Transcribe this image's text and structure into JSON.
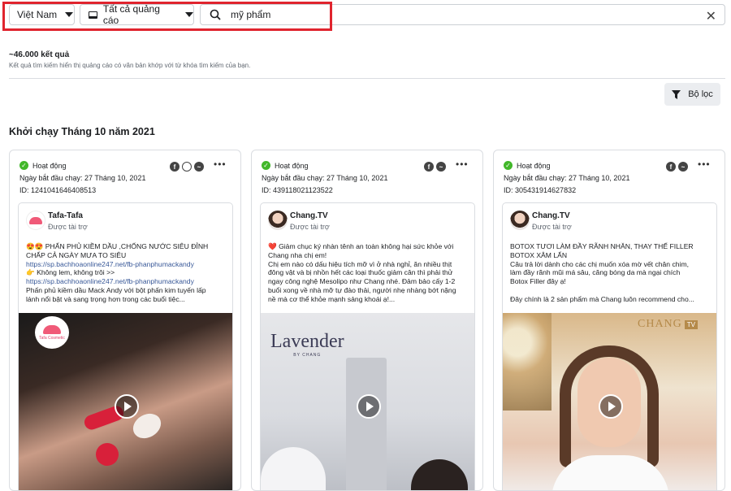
{
  "filters": {
    "country": "Việt Nam",
    "ad_type": "Tất cả quảng cáo",
    "search_value": "mỹ phẩm"
  },
  "results": {
    "count": "~46.000 kết quả",
    "subtitle": "Kết quả tìm kiếm hiển thị quảng cáo có văn bản khớp với từ khóa tìm kiếm của bạn.",
    "filter_label": "Bộ lọc",
    "section_title": "Khởi chạy Tháng 10 năm 2021"
  },
  "cards": [
    {
      "status": "Hoạt động",
      "start": "Ngày bắt đầu chạy: 27 Tháng 10, 2021",
      "id": "ID: 1241041646408513",
      "page_name": "Tafa-Tafa",
      "sponsored": "Được tài trợ",
      "lines": [
        "😍😍 PHẤN PHỦ KIỀM DẦU ,CHỐNG NƯỚC SIÊU ĐỈNH",
        "CHẤP CẢ NGÀY MƯA TO SIÊU",
        "https://sp.bachhoaonline247.net/fb-phanphumackandy",
        "👉 Không lem, không trôi >>",
        "https://sp.bachhoaonline247.net/fb-phanphumackandy",
        "Phấn phủ kiềm dầu Mack Andy với bột phấn kim tuyến lấp",
        "lánh nổi bật và sang trọng hơn trong các buổi tiệc..."
      ],
      "media_logo": "Tafa Cosmetic"
    },
    {
      "status": "Hoạt động",
      "start": "Ngày bắt đầu chạy: 27 Tháng 10, 2021",
      "id": "ID: 439118021123522",
      "page_name": "Chang.TV",
      "sponsored": "Được tài trợ",
      "lines": [
        "❤️ Giảm chục ký nhàn tênh an toàn không hại sức khỏe với",
        "Chang nha chị em!",
        "Chị em nào có dấu hiệu tích mỡ vì ở nhà nghỉ, ăn nhiều thịt",
        "đông vật và bị nhồn hết các loại thuốc giảm cân thì phải thử",
        "ngay công nghệ Mesolipo như Chang nhé. Đảm bảo cấy 1-2",
        "buổi xong về nhà mỡ tự đào thải, người nhẹ nhàng bớt nặng",
        "nề mà cơ thể khỏe mạnh sảng khoái ạ!..."
      ],
      "media_logo": "Lavender",
      "media_logo_sub": "BY CHANG"
    },
    {
      "status": "Hoạt động",
      "start": "Ngày bắt đầu chạy: 27 Tháng 10, 2021",
      "id": "ID: 305431914627832",
      "page_name": "Chang.TV",
      "sponsored": "Được tài trợ",
      "lines": [
        "BOTOX TƯƠI LÀM ĐẦY RÃNH NHĂN, THAY THẾ FILLER",
        "BOTOX XÂM LẤN",
        "Câu trả lời dành cho các chị muốn xóa mờ vết chân chim,",
        "làm đầy rãnh mũi má sâu, căng bóng da mà ngại chích",
        "Botox Filler đây ạ!",
        "",
        "Đây chính là 2 sản phẩm mà Chang luôn recommend cho..."
      ],
      "media_logo": "CHANG",
      "media_logo_sub": "TV"
    }
  ]
}
